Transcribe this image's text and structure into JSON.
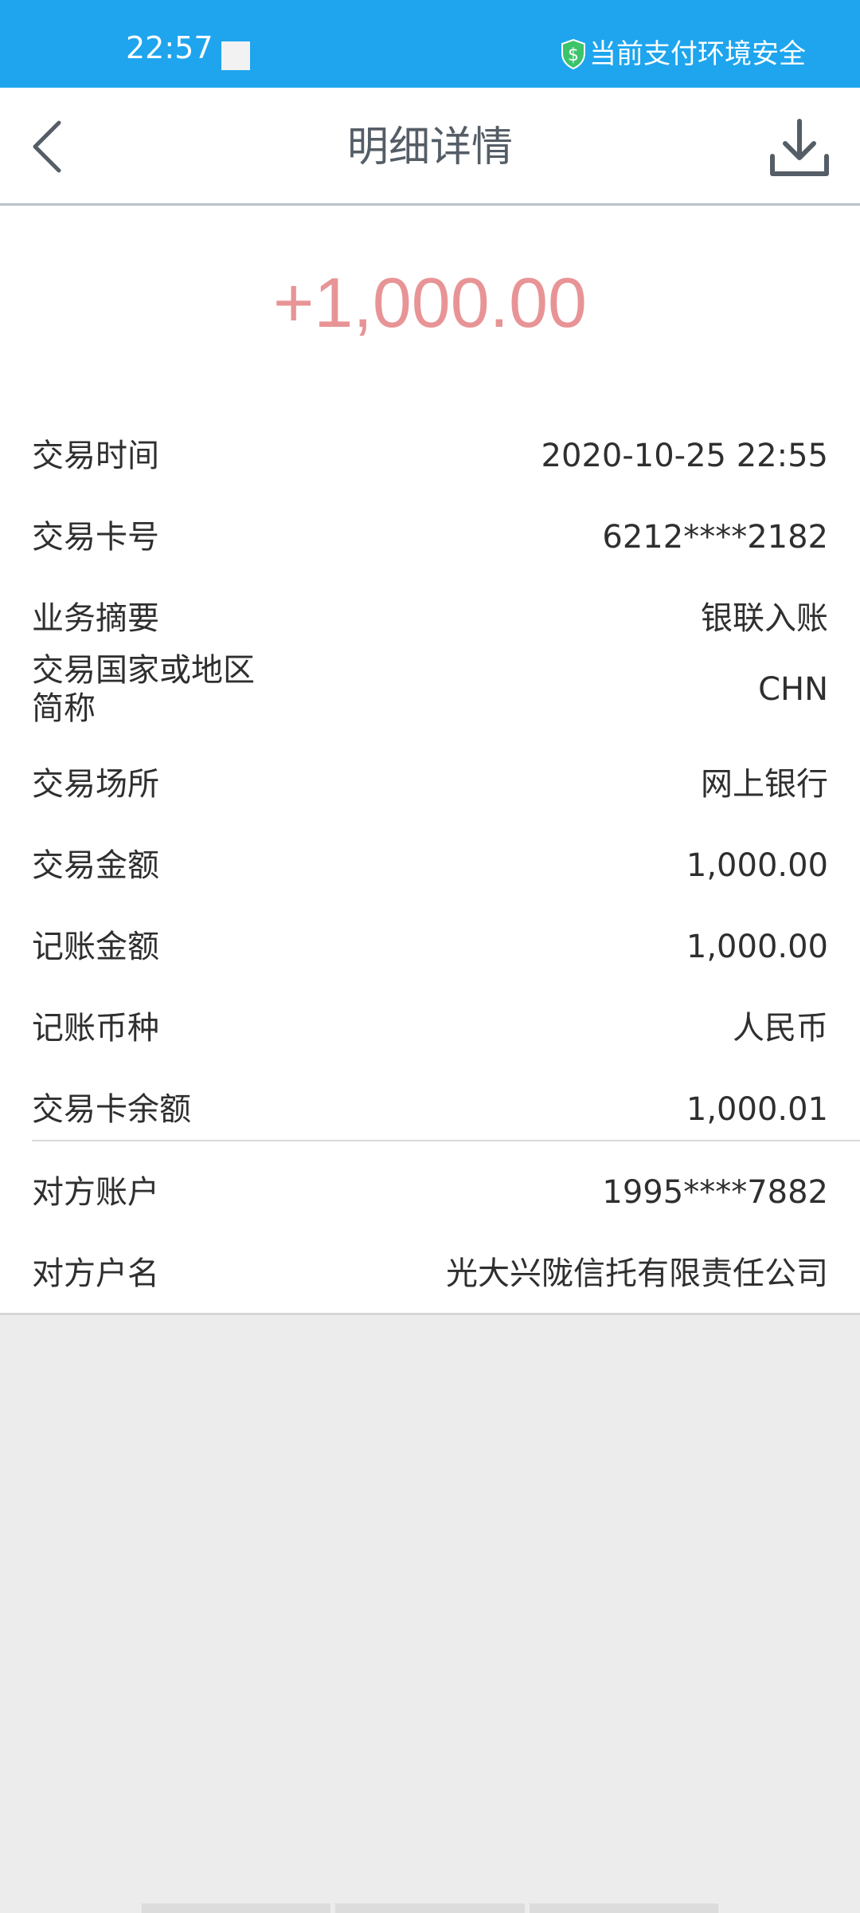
{
  "status_bar": {
    "time": "22:57",
    "security_text": "当前支付环境安全",
    "bar_color": "#1ea5ee"
  },
  "header": {
    "title": "明细详情",
    "back_icon": "chevron-left-icon",
    "download_icon": "download-icon"
  },
  "detail": {
    "amount": "+1,000.00",
    "amount_color": "#e89496",
    "rows": [
      {
        "label": "交易时间",
        "value": "2020-10-25 22:55"
      },
      {
        "label": "交易卡号",
        "value": "6212****2182"
      },
      {
        "label": "业务摘要",
        "value": "银联入账"
      },
      {
        "label_line1": "交易国家或地区",
        "label_line2": "简称",
        "value": "CHN"
      },
      {
        "label": "交易场所",
        "value": "网上银行"
      },
      {
        "label": "交易金额",
        "value": "1,000.00"
      },
      {
        "label": "记账金额",
        "value": "1,000.00"
      },
      {
        "label": "记账币种",
        "value": "人民币"
      },
      {
        "label": "交易卡余额",
        "value": "1,000.01"
      }
    ],
    "counterparty": [
      {
        "label": "对方账户",
        "value": "1995****7882"
      },
      {
        "label": "对方户名",
        "value": "光大兴陇信托有限责任公司"
      }
    ]
  }
}
